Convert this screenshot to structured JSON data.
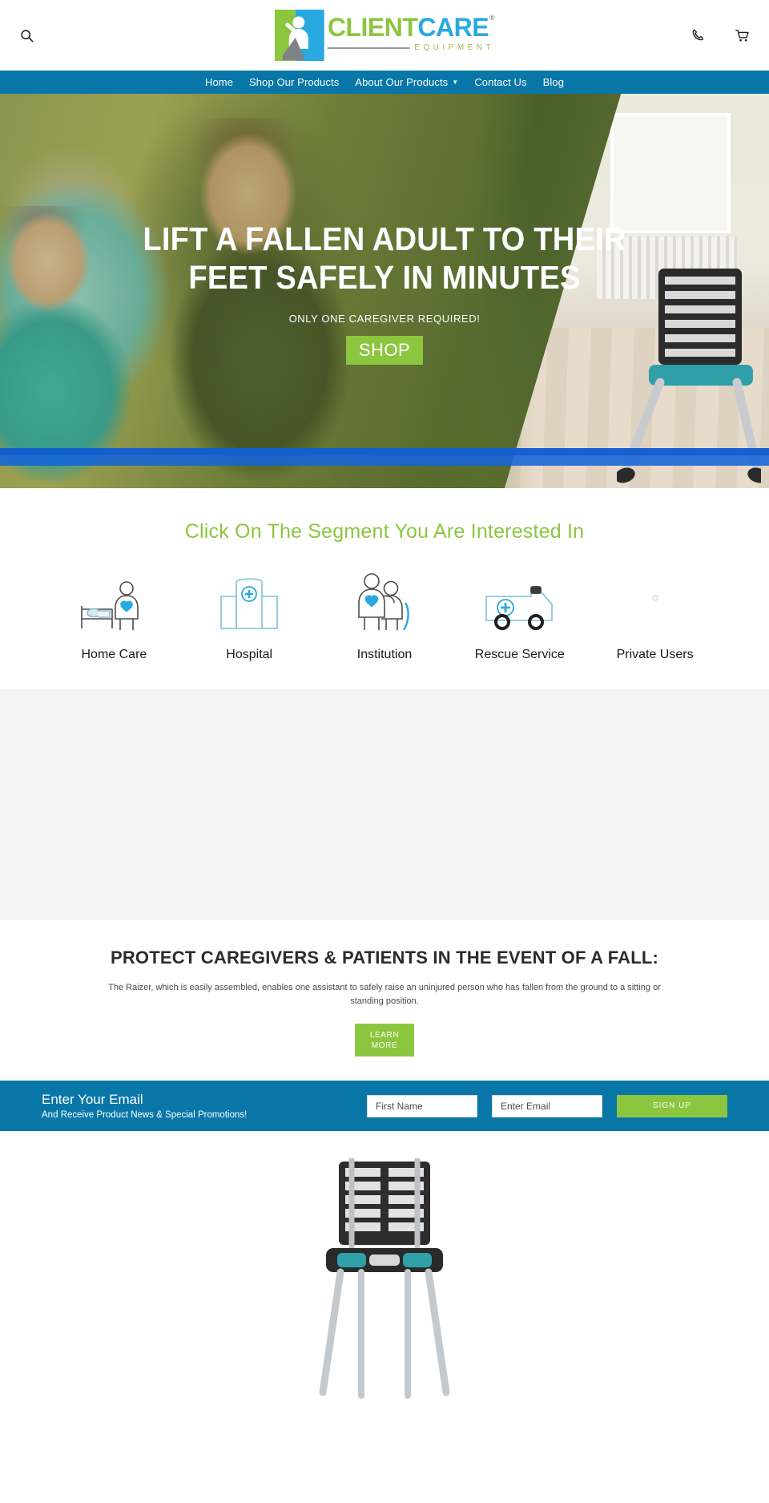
{
  "header": {
    "search_icon": "search-icon",
    "phone_icon": "phone-icon",
    "cart_icon": "cart-icon",
    "logo": {
      "word_one": "CLIENT",
      "word_two": "CARE",
      "registered": "®",
      "tagline": "EQUIPMENT",
      "green": "#8cc63f",
      "blue": "#29a9e0"
    }
  },
  "nav": {
    "background": "#0877a8",
    "items": [
      {
        "label": "Home",
        "has_dropdown": false
      },
      {
        "label": "Shop Our Products",
        "has_dropdown": false
      },
      {
        "label": "About Our Products",
        "has_dropdown": true
      },
      {
        "label": "Contact Us",
        "has_dropdown": false
      },
      {
        "label": "Blog",
        "has_dropdown": false
      }
    ]
  },
  "hero": {
    "title": "LIFT A FALLEN ADULT TO THEIR FEET SAFELY IN MINUTES",
    "subtitle": "ONLY ONE CAREGIVER REQUIRED!",
    "button_label": "SHOP",
    "button_color": "#8cc63f",
    "stripe_color": "#1464d8"
  },
  "segments": {
    "title": "Click On The Segment You Are Interested In",
    "title_color": "#8cc63f",
    "items": [
      {
        "label": "Home Care",
        "icon": "home-care-icon"
      },
      {
        "label": "Hospital",
        "icon": "hospital-icon"
      },
      {
        "label": "Institution",
        "icon": "institution-icon"
      },
      {
        "label": "Rescue Service",
        "icon": "ambulance-icon"
      },
      {
        "label": "Private Users",
        "icon": "private-users-icon"
      }
    ]
  },
  "protect": {
    "title": "PROTECT CAREGIVERS & PATIENTS IN THE EVENT OF A FALL:",
    "text": "The Raizer, which is easily assembled, enables one assistant to safely raise an uninjured person who has fallen from the ground to a sitting or standing position.",
    "button_line_one": "LEARN",
    "button_line_two": "MORE",
    "button_color": "#8cc63f"
  },
  "signup": {
    "background": "#0877a8",
    "heading": "Enter Your Email",
    "subheading": "And Receive Product News & Special Promotions!",
    "first_name_placeholder": "First Name",
    "first_name_value": "",
    "email_placeholder": "Enter Email",
    "email_value": "",
    "submit_label": "SIGN UP",
    "submit_color": "#8cc63f"
  },
  "product": {
    "alt": "raizer-chair-product-image"
  }
}
